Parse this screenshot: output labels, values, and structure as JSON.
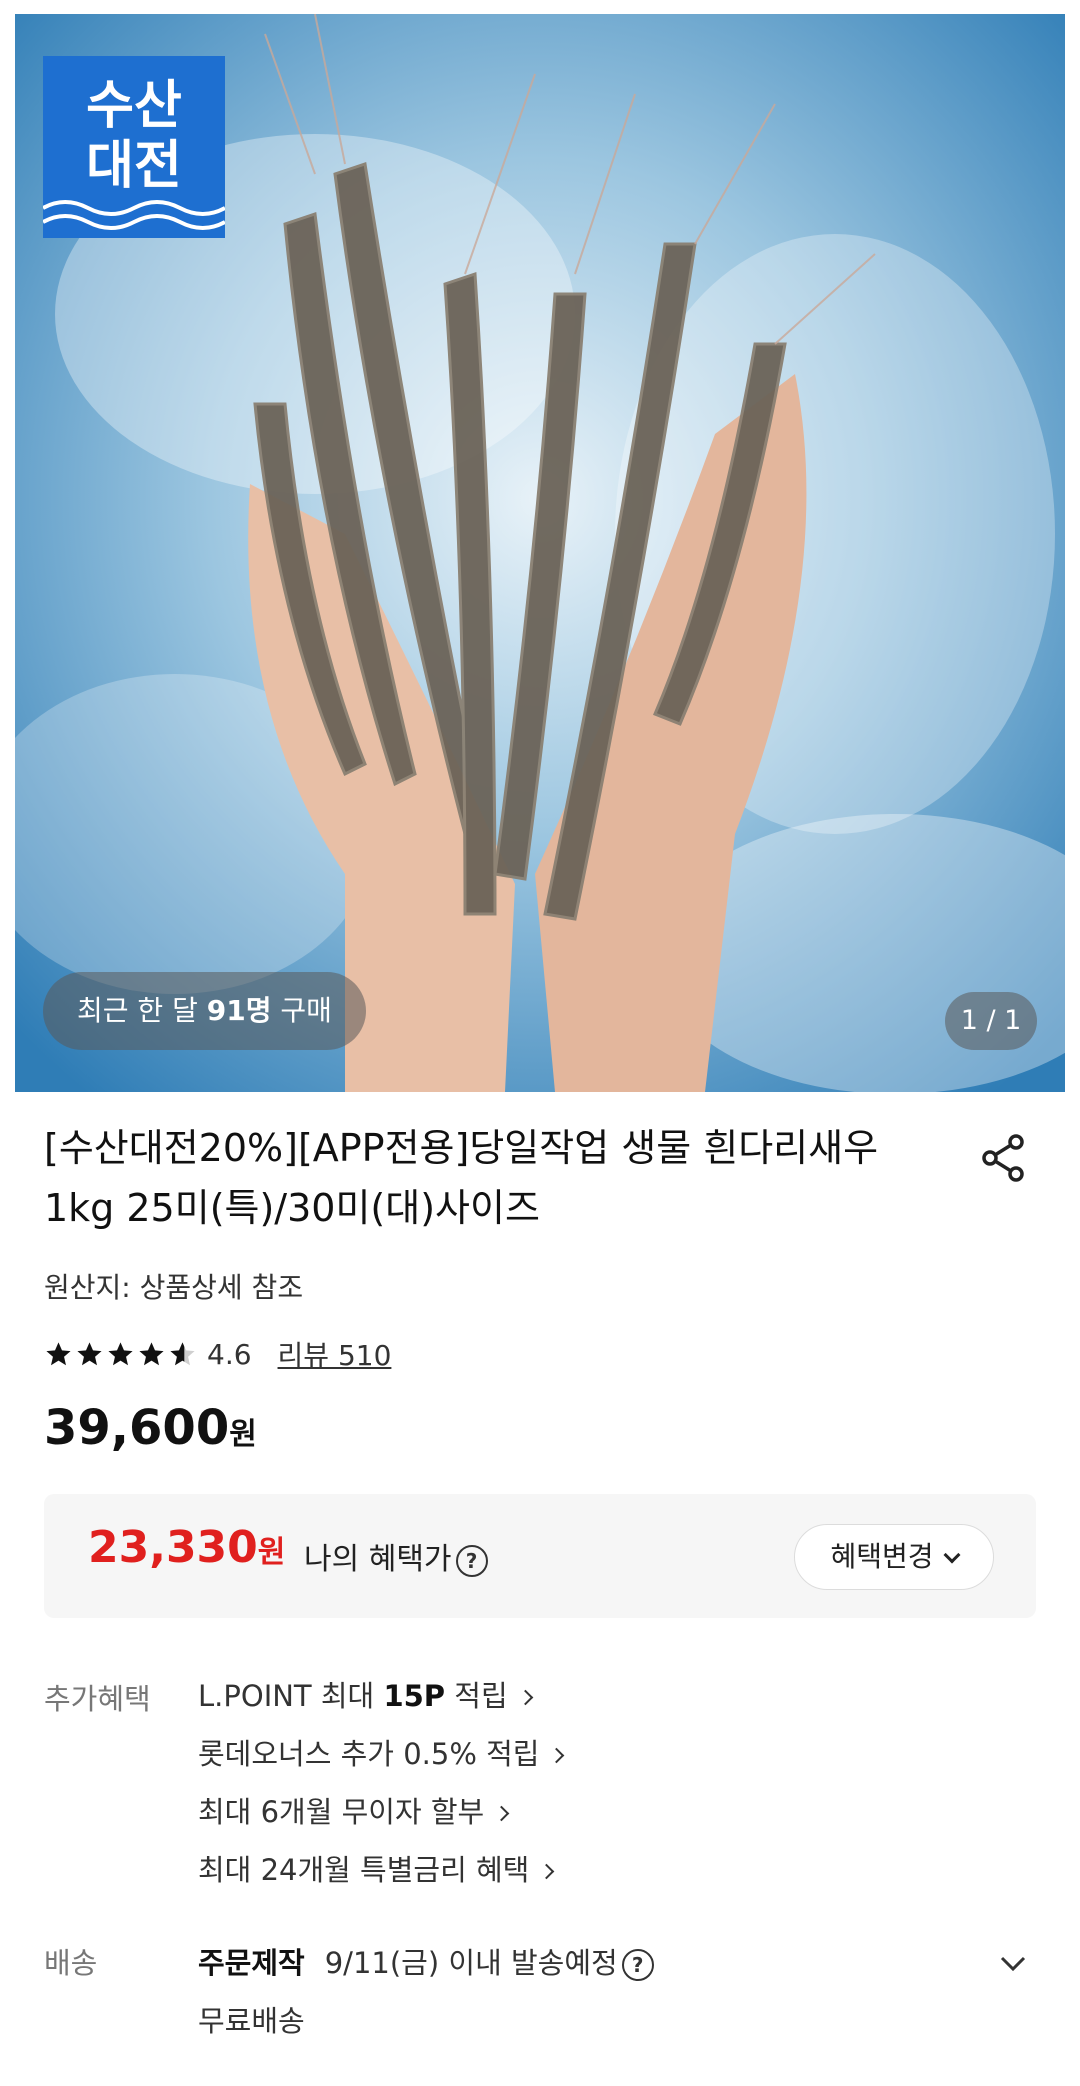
{
  "hero": {
    "logo_line1": "수산",
    "logo_line2": "대전",
    "buyers_prefix": "최근 한 달 ",
    "buyers_count": "91명",
    "buyers_suffix": " 구매",
    "page_indicator": "1 / 1"
  },
  "product": {
    "title": "[수산대전20%][APP전용]당일작업 생물 흰다리새우 1kg 25미(특)/30미(대)사이즈",
    "origin": "원산지: 상품상세 참조",
    "rating": "4.6",
    "rating_value": 4.6,
    "review_link": "리뷰 510",
    "price_amount": "39,600",
    "price_unit": "원"
  },
  "benefit": {
    "price_amount": "23,330",
    "price_unit": "원",
    "label": "나의 혜택가",
    "help_icon": "?",
    "change_button": "혜택변경"
  },
  "extra_benefits": {
    "label": "추가혜택",
    "items": [
      {
        "prefix": "L.POINT 최대 ",
        "bold": "15P",
        "suffix": " 적립"
      },
      {
        "prefix": "롯데오너스 추가 0.5% 적립",
        "bold": "",
        "suffix": ""
      },
      {
        "prefix": "최대 6개월 무이자 할부",
        "bold": "",
        "suffix": ""
      },
      {
        "prefix": "최대 24개월 특별금리 혜택",
        "bold": "",
        "suffix": ""
      }
    ]
  },
  "shipping": {
    "label": "배송",
    "type": "주문제작",
    "schedule": "9/11(금) 이내 발송예정",
    "help_icon": "?",
    "fee": "무료배송"
  },
  "colors": {
    "accent_red": "#e0201e",
    "logo_blue": "#1e6fd0"
  },
  "icons": {
    "share": "share-icon",
    "star": "star-icon",
    "chevron_down": "chevron-down-icon",
    "chevron_right": "chevron-right-icon",
    "help": "help-circle-icon"
  }
}
